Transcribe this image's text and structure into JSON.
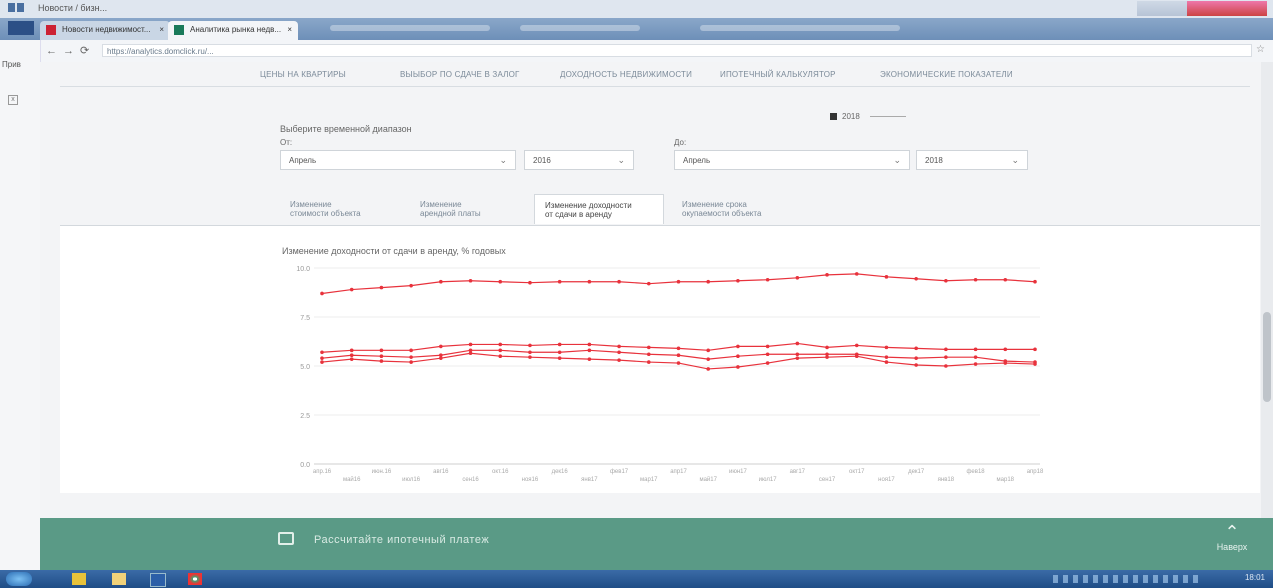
{
  "browser": {
    "title_text": "Новости / бизн...",
    "tabs": [
      {
        "label": "Новости недвижимост...",
        "close": "×"
      },
      {
        "label": "Аналитика рынка недв...",
        "close": "×"
      }
    ],
    "url": "https://analytics.domclick.ru/...",
    "sidebar_label": "Прив"
  },
  "page": {
    "menu": [
      "ЦЕНЫ НА КВАРТИРЫ",
      "ВЫЫБОР ПО СДАЧЕ В ЗАЛОГ",
      "ДОХОДНОСТЬ НЕДВИЖИМОСТИ",
      "ИПОТЕЧНЫЙ КАЛЬКУЛЯТОР",
      "ЭКОНОМИЧЕСКИЕ ПОКАЗАТЕЛИ"
    ],
    "legend_label": "2018",
    "range_title": "Выберите временной диапазон",
    "from_label": "От:",
    "to_label": "До:",
    "from_month": "Апрель",
    "from_year": "2016",
    "to_month": "Апрель",
    "to_year": "2018",
    "chevron": "⌄",
    "tabs": [
      {
        "line1": "Изменение",
        "line2": "стоимости объекта"
      },
      {
        "line1": "Изменение",
        "line2": "арендной платы"
      },
      {
        "line1": "Изменение доходности",
        "line2": "от сдачи в аренду"
      },
      {
        "line1": "Изменение срока",
        "line2": "окупаемости объекта"
      }
    ],
    "chart_title": "Изменение доходности от сдачи в аренду, % годовых"
  },
  "chart_data": {
    "type": "line",
    "title": "Изменение доходности от сдачи в аренду, % годовых",
    "ylim": [
      0,
      10
    ],
    "yticks": [
      "0.0",
      "2.5",
      "5.0",
      "7.5",
      "10.0"
    ],
    "x": [
      "апр.16",
      "май16",
      "июн.16",
      "июл16",
      "авг16",
      "сен16",
      "окт.16",
      "ноя16",
      "дек16",
      "янв17",
      "фев17",
      "мар17",
      "апр17",
      "май17",
      "июн17",
      "июл17",
      "авг17",
      "сен17",
      "окт17",
      "ноя17",
      "дек17",
      "янв18",
      "фев18",
      "мар18",
      "апр18"
    ],
    "xticks_top": [
      "апр.16",
      "июн.16",
      "авг16",
      "окт.16",
      "дек16",
      "фев17",
      "апр17",
      "июн17",
      "авг17",
      "окт17",
      "дек17",
      "фев18",
      "апр18"
    ],
    "xticks_bottom": [
      "май16",
      "июл16",
      "сен16",
      "ноя16",
      "янв17",
      "мар17",
      "май17",
      "июл17",
      "сен17",
      "ноя17",
      "янв18",
      "мар18"
    ],
    "series": [
      {
        "values": [
          8.7,
          8.9,
          9.0,
          9.1,
          9.3,
          9.35,
          9.3,
          9.25,
          9.3,
          9.3,
          9.3,
          9.2,
          9.3,
          9.3,
          9.35,
          9.4,
          9.5,
          9.65,
          9.7,
          9.55,
          9.45,
          9.35,
          9.4,
          9.4,
          9.3
        ]
      },
      {
        "values": [
          5.7,
          5.8,
          5.8,
          5.8,
          6.0,
          6.1,
          6.1,
          6.05,
          6.1,
          6.1,
          6.0,
          5.95,
          5.9,
          5.8,
          6.0,
          6.0,
          6.15,
          5.95,
          6.05,
          5.95,
          5.9,
          5.85,
          5.85,
          5.85,
          5.85
        ]
      },
      {
        "values": [
          5.4,
          5.55,
          5.5,
          5.45,
          5.55,
          5.8,
          5.8,
          5.7,
          5.7,
          5.8,
          5.7,
          5.6,
          5.55,
          5.35,
          5.5,
          5.6,
          5.6,
          5.6,
          5.6,
          5.45,
          5.4,
          5.45,
          5.45,
          5.25,
          5.2
        ]
      },
      {
        "values": [
          5.2,
          5.35,
          5.25,
          5.2,
          5.4,
          5.65,
          5.5,
          5.45,
          5.4,
          5.35,
          5.3,
          5.2,
          5.15,
          4.85,
          4.95,
          5.15,
          5.4,
          5.45,
          5.5,
          5.2,
          5.05,
          5.0,
          5.1,
          5.15,
          5.1
        ]
      }
    ],
    "color": "#e8323c",
    "grid": true
  },
  "banner": {
    "text": "Рассчитайте ипотечный платеж",
    "up_label": "Наверх"
  },
  "taskbar": {
    "clock": "18:01"
  }
}
